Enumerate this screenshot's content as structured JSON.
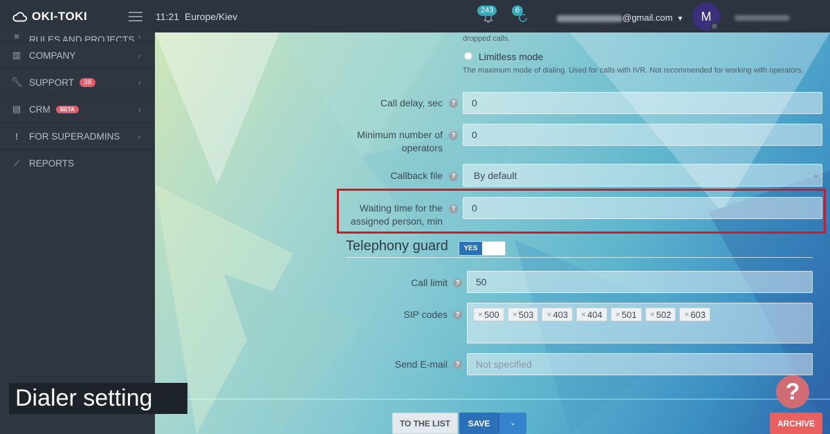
{
  "header": {
    "logo_text": "OKI-TOKI",
    "time": "11:21",
    "timezone": "Europe/Kiev",
    "notifications_count": "243",
    "calls_count": "6",
    "email_suffix": "@gmail.com",
    "avatar_letter": "M"
  },
  "sidebar": {
    "items": [
      {
        "label": "RULES AND PROJECTS",
        "icon": "rules-icon"
      },
      {
        "label": "COMPANY",
        "icon": "chart-icon"
      },
      {
        "label": "SUPPORT",
        "icon": "wrench-icon",
        "badge": "38"
      },
      {
        "label": "CRM",
        "icon": "crm-icon",
        "badge": "BETA"
      },
      {
        "label": "FOR SUPERADMINS",
        "icon": "exclamation-icon"
      },
      {
        "label": "REPORTS",
        "icon": "line-chart-icon"
      }
    ]
  },
  "form": {
    "dropped_calls_text": "dropped calls.",
    "limitless_label": "Limitless mode",
    "limitless_desc": "The maximum mode of dialing. Used for calls with IVR. Not recommended for working with operators.",
    "call_delay_label": "Call delay, sec",
    "call_delay_value": "0",
    "min_ops_label": "Minimum number of operators",
    "min_ops_value": "0",
    "callback_file_label": "Callback file",
    "callback_file_value": "By default",
    "waiting_label": "Waiting time for the assigned person, min",
    "waiting_value": "0"
  },
  "guard": {
    "title": "Telephony guard",
    "toggle_label": "YES",
    "call_limit_label": "Call limit",
    "call_limit_value": "50",
    "sip_codes_label": "SIP codes",
    "sip_codes": [
      "500",
      "503",
      "403",
      "404",
      "501",
      "502",
      "603"
    ],
    "email_label": "Send E-mail",
    "email_placeholder": "Not specified"
  },
  "buttons": {
    "to_list": "TO THE LIST",
    "save": "SAVE",
    "archive": "ARCHIVE"
  },
  "caption": "Dialer setting",
  "help_fab": "?"
}
